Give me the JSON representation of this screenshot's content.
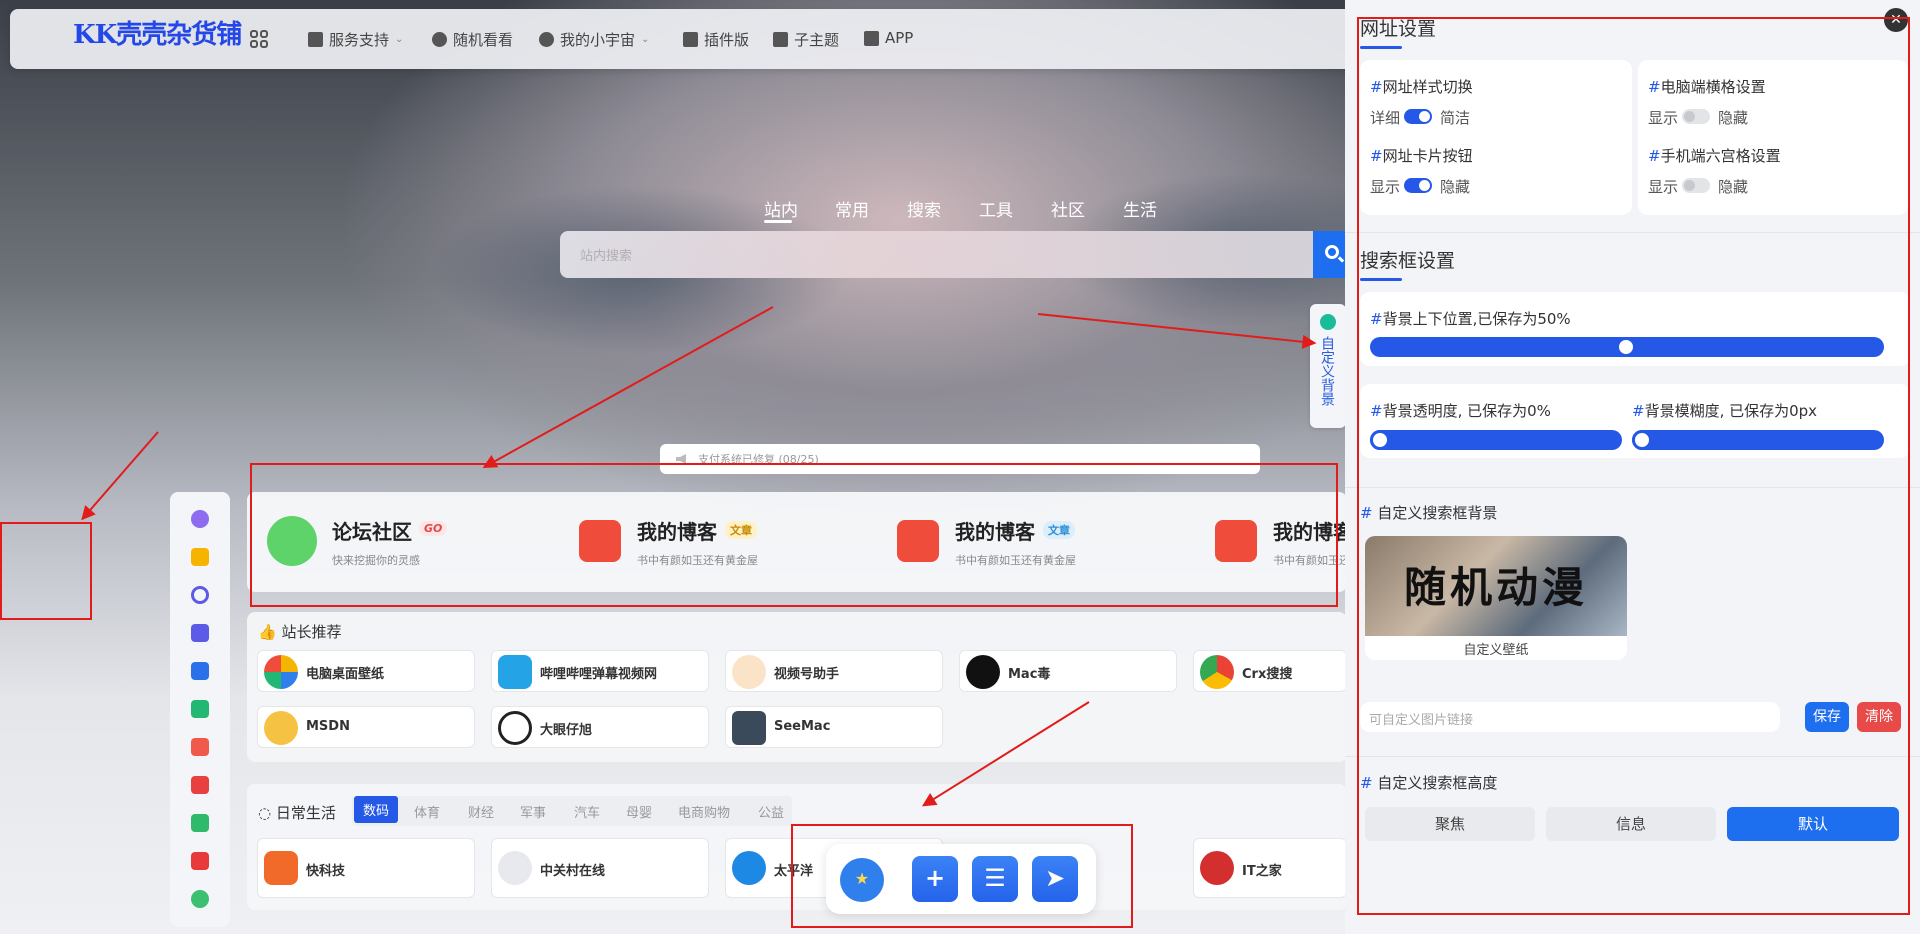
{
  "brand": {
    "logo": "KK壳壳杂货铺"
  },
  "nav": [
    {
      "label": "服务支持",
      "has_dropdown": true
    },
    {
      "label": "随机看看"
    },
    {
      "label": "我的小宇宙",
      "has_dropdown": true
    },
    {
      "label": "插件版"
    },
    {
      "label": "子主题"
    },
    {
      "label": "APP"
    }
  ],
  "search": {
    "tabs": [
      "站内",
      "常用",
      "搜索",
      "工具",
      "社区",
      "生活"
    ],
    "active_tab": "站内",
    "placeholder": "站内搜索"
  },
  "custom_bg_tab": "自定义背景",
  "notice": "支付系统已修复 (08/25)",
  "featured": [
    {
      "title": "论坛社区",
      "badge": "GO",
      "sub": "快来挖掘你的灵感",
      "color": "#2fc94c"
    },
    {
      "title": "我的博客",
      "badge": "文章",
      "sub": "书中有颜如玉还有黄金屋",
      "color": "#ee4433"
    },
    {
      "title": "我的博客",
      "badge": "文章",
      "sub": "书中有颜如玉还有黄金屋",
      "color": "#ee4433"
    },
    {
      "title": "我的博客",
      "badge": "",
      "sub": "书中有颜如玉还",
      "color": "#ee4433"
    }
  ],
  "recommend": {
    "title": "站长推荐",
    "sites": [
      "电脑桌面壁纸",
      "哔哩哔哩弹幕视频网",
      "视频号助手",
      "Mac毒",
      "Crx搜搜",
      "MSDN",
      "大眼仔旭",
      "SeeMac"
    ]
  },
  "daily": {
    "title": "日常生活",
    "tabs": [
      "数码",
      "体育",
      "财经",
      "军事",
      "汽车",
      "母婴",
      "电商购物",
      "公益"
    ],
    "active": "数码",
    "sites": [
      "快科技",
      "中关村在线",
      "太平洋",
      "IT之家"
    ]
  },
  "toolbar": {
    "buttons": [
      "star",
      "+",
      "list",
      "send"
    ]
  },
  "panel": {
    "url_section": "网址设置",
    "url_style": {
      "label": "网址样式切换",
      "left": "详细",
      "right": "简洁",
      "on": true
    },
    "pc_bar": {
      "label": "电脑端横格设置",
      "left": "显示",
      "right": "隐藏",
      "on": false
    },
    "card_btn": {
      "label": "网址卡片按钮",
      "left": "显示",
      "right": "隐藏",
      "on": true
    },
    "mobile_grid": {
      "label": "手机端六宫格设置",
      "left": "显示",
      "right": "隐藏",
      "on": false
    },
    "search_section": "搜索框设置",
    "bg_pos": {
      "label": "背景上下位置,已保存为50%",
      "value": 50
    },
    "bg_opacity": {
      "label": "背景透明度, 已保存为0%",
      "value": 0
    },
    "bg_blur": {
      "label": "背景模糊度, 已保存为0px",
      "value": 0
    },
    "custom_bg_title": "自定义搜索框背景",
    "wallpaper_text": "随机动漫",
    "wallpaper_caption": "自定义壁纸",
    "img_link_placeholder": "可自定义图片链接",
    "save": "保存",
    "clear": "清除",
    "height_title": "自定义搜索框高度",
    "height_opts": [
      "聚焦",
      "信息",
      "默认"
    ],
    "height_active": "默认"
  },
  "hash": "#"
}
